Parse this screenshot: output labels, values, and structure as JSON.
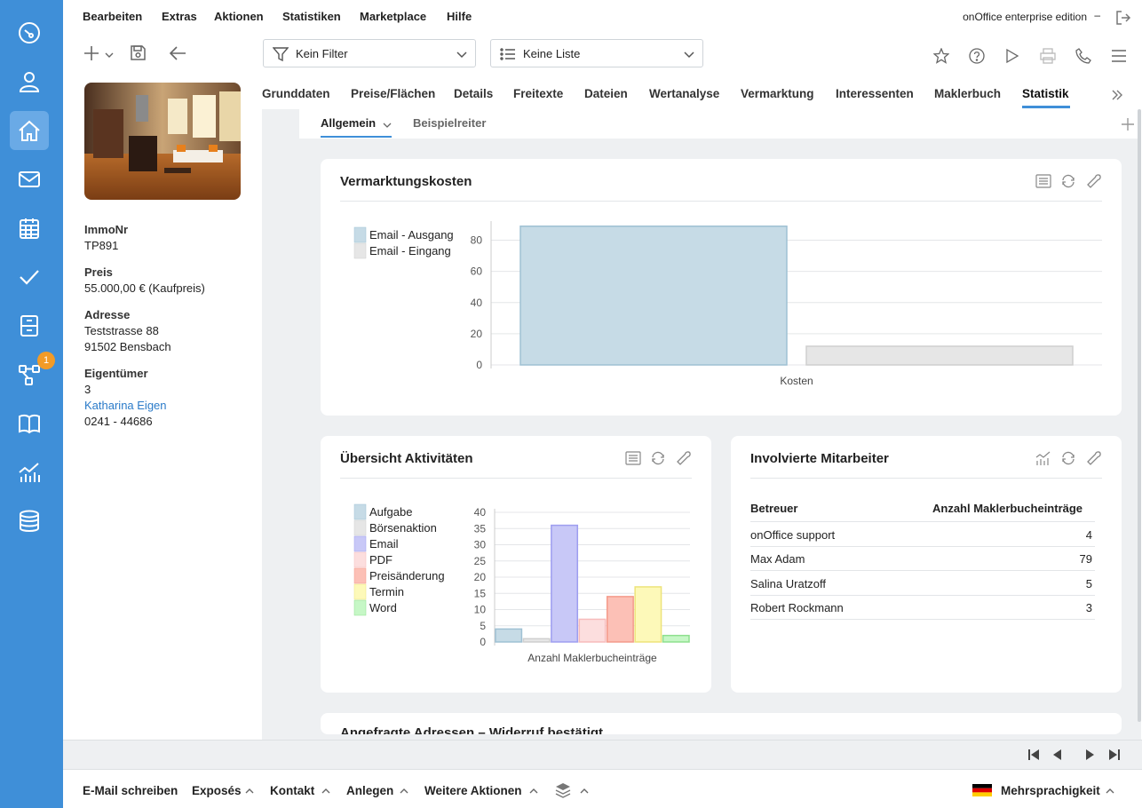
{
  "menu": {
    "items": [
      "Bearbeiten",
      "Extras",
      "Aktionen",
      "Statistiken",
      "Marketplace",
      "Hilfe"
    ],
    "edition": "onOffice enterprise edition",
    "edition_dash": "–"
  },
  "sidebar": {
    "icons": [
      "speedometer-icon",
      "person-icon",
      "home-icon",
      "mail-icon",
      "calendar-icon",
      "checkmark-icon",
      "file-cabinet-icon",
      "workflow-icon",
      "book-icon",
      "statistics-icon",
      "database-icon"
    ],
    "active": "home-icon",
    "badge": "1"
  },
  "filters": {
    "filter_label": "Kein Filter",
    "list_label": "Keine Liste"
  },
  "property": {
    "fields": [
      {
        "label": "ImmoNr",
        "values": [
          "TP891"
        ]
      },
      {
        "label": "Preis",
        "values": [
          "55.000,00 € (Kaufpreis)"
        ]
      },
      {
        "label": "Adresse",
        "values": [
          "Teststrasse 88",
          "91502 Bensbach"
        ]
      },
      {
        "label": "Eigentümer",
        "values": [
          "3"
        ]
      }
    ],
    "owner_link": "Katharina Eigen",
    "owner_phone": "0241 - 44686"
  },
  "tabs": [
    "Grunddaten",
    "Preise/Flächen",
    "Details",
    "Freitexte",
    "Dateien",
    "Wertanalyse",
    "Vermarktung",
    "Interessenten",
    "Maklerbuch",
    "Statistik"
  ],
  "active_tab": "Statistik",
  "subtabs": [
    "Allgemein",
    "Beispielreiter"
  ],
  "cards": {
    "kosten_title": "Vermarktungskosten",
    "aktivitaeten_title": "Übersicht Aktivitäten",
    "mitarbeiter_title": "Involvierte Mitarbeiter",
    "partial_title": "Angefragte Adressen – Widerruf bestätigt"
  },
  "chart_data": [
    {
      "type": "bar",
      "title": "Vermarktungskosten",
      "categories": [
        "Kosten"
      ],
      "series": [
        {
          "name": "Email - Ausgang",
          "values": [
            89
          ],
          "color": "#c6dbe6"
        },
        {
          "name": "Email - Eingang",
          "values": [
            12
          ],
          "color": "#e6e6e6"
        }
      ],
      "ylim": [
        0,
        90
      ],
      "yticks": [
        0,
        20,
        40,
        60,
        80
      ],
      "legend": "top-left",
      "grid": true
    },
    {
      "type": "bar",
      "title": "Übersicht Aktivitäten",
      "categories": [
        "Anzahl Maklerbucheinträge"
      ],
      "series": [
        {
          "name": "Aufgabe",
          "values": [
            4
          ],
          "color": "#c6dbe6"
        },
        {
          "name": "Börsenaktion",
          "values": [
            1
          ],
          "color": "#e6e6e6"
        },
        {
          "name": "Email",
          "values": [
            36
          ],
          "color": "#c8c8f7"
        },
        {
          "name": "PDF",
          "values": [
            7
          ],
          "color": "#fcdede"
        },
        {
          "name": "Preisänderung",
          "values": [
            14
          ],
          "color": "#fcc0b6"
        },
        {
          "name": "Termin",
          "values": [
            17
          ],
          "color": "#fdf9b9"
        },
        {
          "name": "Word",
          "values": [
            2
          ],
          "color": "#c6f7c6"
        }
      ],
      "ylim": [
        0,
        40
      ],
      "yticks": [
        0,
        5,
        10,
        15,
        20,
        25,
        30,
        35,
        40
      ],
      "legend": "left",
      "grid": true
    }
  ],
  "legend_border_colors": [
    "#9fc1d3",
    "#cfcfcf",
    "#9e9ef0",
    "#f7bcbc",
    "#f49a8a",
    "#ede37a",
    "#8fe08f"
  ],
  "mitarbeiter": {
    "headers": [
      "Betreuer",
      "Anzahl Maklerbucheinträge"
    ],
    "rows": [
      {
        "name": "onOffice support",
        "count": "4"
      },
      {
        "name": "Max Adam",
        "count": "79"
      },
      {
        "name": "Salina Uratzoff",
        "count": "5"
      },
      {
        "name": "Robert Rockmann",
        "count": "3"
      }
    ]
  },
  "bottom_actions": [
    "E-Mail schreiben",
    "Exposés",
    "Kontakt",
    "Anlegen",
    "Weitere Aktionen"
  ],
  "multilingual": "Mehrsprachigkeit",
  "colors": {
    "accent": "#3f8fd8",
    "rail": "#3f8fd8",
    "link": "#2b7bc9",
    "badge": "#f29b27"
  }
}
